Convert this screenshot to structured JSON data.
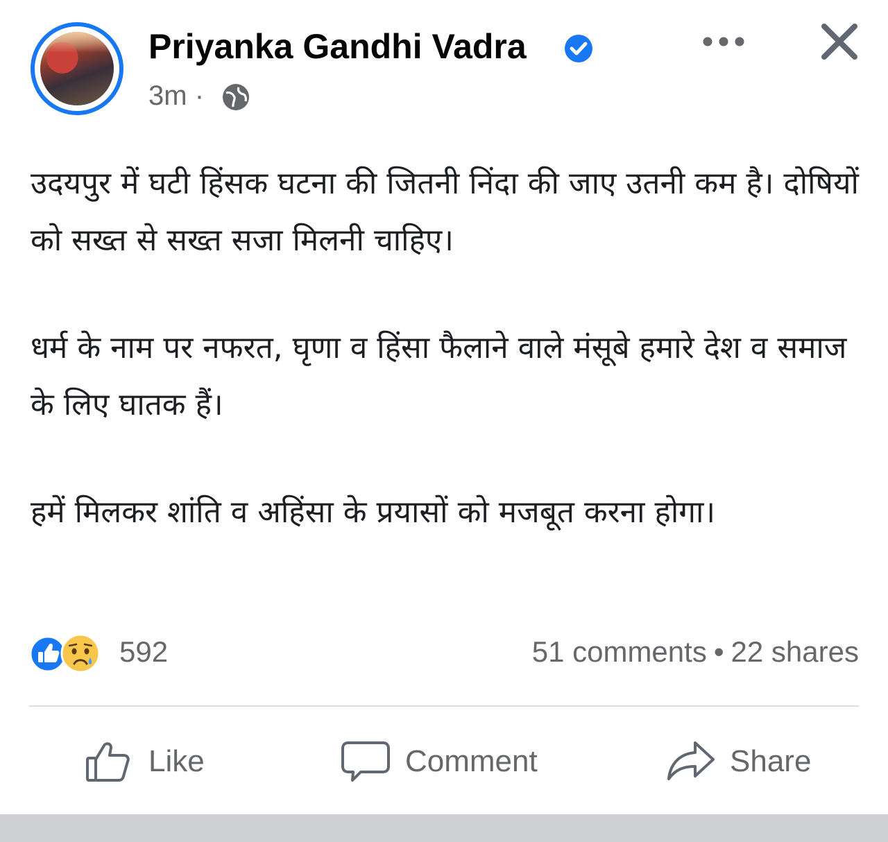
{
  "header": {
    "author_name": "Priyanka Gandhi Vadra",
    "timestamp": "3m",
    "separator": "·",
    "verified_icon": "verified-badge-icon",
    "privacy_icon": "globe-icon",
    "more_icon": "more-options-icon",
    "close_icon": "close-icon"
  },
  "post": {
    "paragraphs": [
      "उदयपुर में घटी हिंसक घटना की जितनी निंदा की जाए उतनी कम है। दोषियों को सख्त से सख्त सजा मिलनी चाहिए।",
      "धर्म के नाम पर नफरत, घृणा व हिंसा फैलाने वाले मंसूबे हमारे देश व समाज के लिए घातक हैं।",
      "हमें मिलकर शांति व अहिंसा के प्रयासों को मजबूत करना होगा।"
    ]
  },
  "stats": {
    "reactions_count": "592",
    "comments": "51 comments",
    "shares": "22 shares",
    "dot": "•",
    "reaction_icons": [
      "like-reaction-icon",
      "sad-reaction-icon"
    ]
  },
  "actions": {
    "like_label": "Like",
    "comment_label": "Comment",
    "share_label": "Share"
  },
  "colors": {
    "accent": "#1877f2",
    "secondary_text": "#65676b",
    "primary_text": "#050505"
  }
}
